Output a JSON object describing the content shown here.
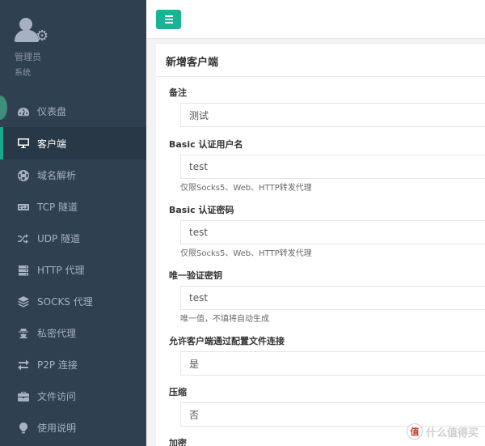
{
  "profile": {
    "role": "管理员",
    "subtitle": "系统"
  },
  "nav": [
    {
      "label": "仪表盘",
      "icon": "dashboard-icon",
      "active": false
    },
    {
      "label": "客户端",
      "icon": "monitor-icon",
      "active": true
    },
    {
      "label": "域名解析",
      "icon": "globe-icon",
      "active": false
    },
    {
      "label": "TCP 隧道",
      "icon": "retweet-icon",
      "active": false
    },
    {
      "label": "UDP 隧道",
      "icon": "shuffle-icon",
      "active": false
    },
    {
      "label": "HTTP 代理",
      "icon": "server-icon",
      "active": false
    },
    {
      "label": "SOCKS 代理",
      "icon": "layers-icon",
      "active": false
    },
    {
      "label": "私密代理",
      "icon": "user-secret-icon",
      "active": false
    },
    {
      "label": "P2P 连接",
      "icon": "exchange-icon",
      "active": false
    },
    {
      "label": "文件访问",
      "icon": "briefcase-icon",
      "active": false
    },
    {
      "label": "使用说明",
      "icon": "lightbulb-icon",
      "active": false
    }
  ],
  "panel": {
    "title": "新增客户端"
  },
  "form": {
    "remark": {
      "label": "备注",
      "value": "测试"
    },
    "basic_user": {
      "label": "Basic 认证用户名",
      "value": "test",
      "help": "仅限Socks5、Web、HTTP转发代理"
    },
    "basic_pass": {
      "label": "Basic 认证密码",
      "value": "test",
      "help": "仅限Socks5、Web、HTTP转发代理"
    },
    "vkey": {
      "label": "唯一验证密钥",
      "value": "test",
      "help": "唯一值，不填将自动生成"
    },
    "config_conn": {
      "label": "允许客户端通过配置文件连接",
      "value": "是"
    },
    "compress": {
      "label": "压缩",
      "value": "否"
    },
    "crypt": {
      "label": "加密"
    }
  },
  "watermark": {
    "logo": "值",
    "text": "什么值得买"
  },
  "colors": {
    "sidebar": "#2f4050",
    "accent": "#1ab394",
    "active_bg": "#293846"
  }
}
